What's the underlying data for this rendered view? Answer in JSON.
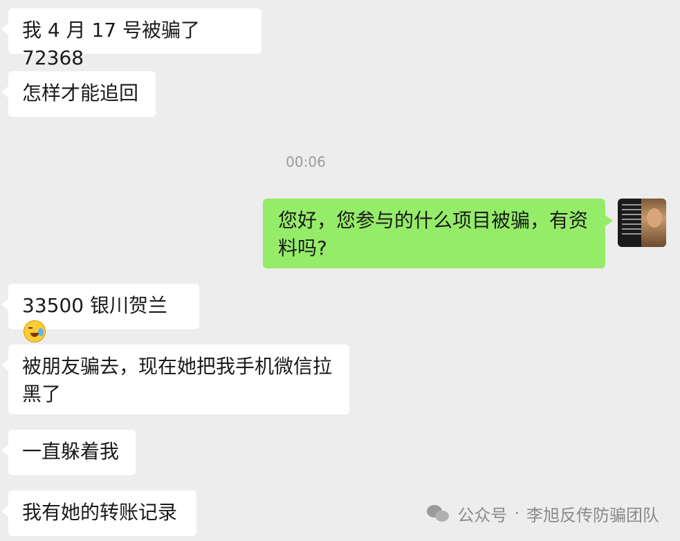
{
  "messages": [
    {
      "side": "in",
      "text": "我 4 月 17 号被骗了 72368"
    },
    {
      "side": "in",
      "text": "怎样才能追回"
    },
    {
      "side": "out",
      "text": "您好，您参与的什么项目被骗，有资料吗?"
    },
    {
      "side": "in",
      "text": "33500 银川贺兰"
    },
    {
      "side": "in",
      "text": "被朋友骗去，现在她把我手机微信拉黑了"
    },
    {
      "side": "in",
      "text": "一直躲着我"
    },
    {
      "side": "in",
      "text": "我有她的转账记录"
    }
  ],
  "timestamp": "00:06",
  "emoji": "crying-face",
  "watermark": {
    "label": "公众号",
    "separator": "·",
    "account": "李旭反传防骗团队",
    "icon": "wechat-icon"
  },
  "colors": {
    "background": "#ededed",
    "incoming_bubble": "#ffffff",
    "outgoing_bubble": "#95ec69"
  }
}
